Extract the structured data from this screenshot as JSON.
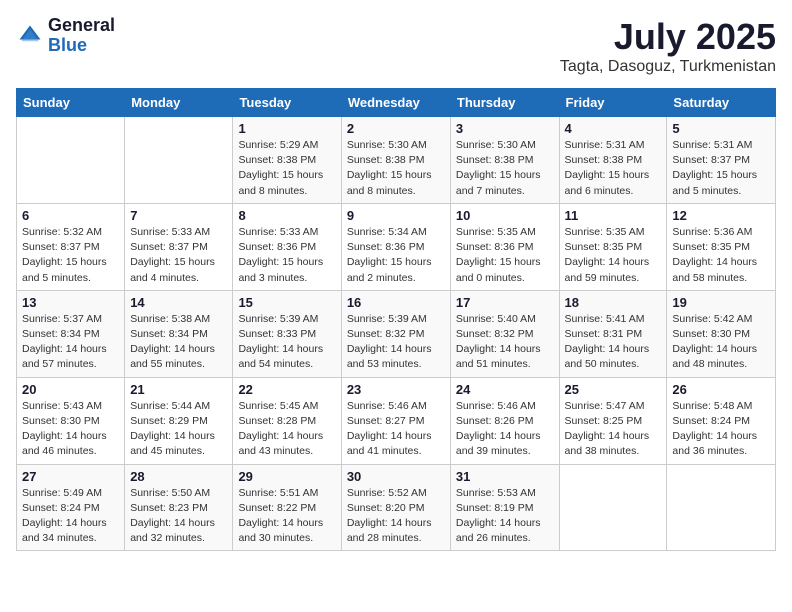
{
  "logo": {
    "general": "General",
    "blue": "Blue"
  },
  "title": "July 2025",
  "subtitle": "Tagta, Dasoguz, Turkmenistan",
  "weekdays": [
    "Sunday",
    "Monday",
    "Tuesday",
    "Wednesday",
    "Thursday",
    "Friday",
    "Saturday"
  ],
  "weeks": [
    [
      {
        "day": "",
        "info": ""
      },
      {
        "day": "",
        "info": ""
      },
      {
        "day": "1",
        "info": "Sunrise: 5:29 AM\nSunset: 8:38 PM\nDaylight: 15 hours and 8 minutes."
      },
      {
        "day": "2",
        "info": "Sunrise: 5:30 AM\nSunset: 8:38 PM\nDaylight: 15 hours and 8 minutes."
      },
      {
        "day": "3",
        "info": "Sunrise: 5:30 AM\nSunset: 8:38 PM\nDaylight: 15 hours and 7 minutes."
      },
      {
        "day": "4",
        "info": "Sunrise: 5:31 AM\nSunset: 8:38 PM\nDaylight: 15 hours and 6 minutes."
      },
      {
        "day": "5",
        "info": "Sunrise: 5:31 AM\nSunset: 8:37 PM\nDaylight: 15 hours and 5 minutes."
      }
    ],
    [
      {
        "day": "6",
        "info": "Sunrise: 5:32 AM\nSunset: 8:37 PM\nDaylight: 15 hours and 5 minutes."
      },
      {
        "day": "7",
        "info": "Sunrise: 5:33 AM\nSunset: 8:37 PM\nDaylight: 15 hours and 4 minutes."
      },
      {
        "day": "8",
        "info": "Sunrise: 5:33 AM\nSunset: 8:36 PM\nDaylight: 15 hours and 3 minutes."
      },
      {
        "day": "9",
        "info": "Sunrise: 5:34 AM\nSunset: 8:36 PM\nDaylight: 15 hours and 2 minutes."
      },
      {
        "day": "10",
        "info": "Sunrise: 5:35 AM\nSunset: 8:36 PM\nDaylight: 15 hours and 0 minutes."
      },
      {
        "day": "11",
        "info": "Sunrise: 5:35 AM\nSunset: 8:35 PM\nDaylight: 14 hours and 59 minutes."
      },
      {
        "day": "12",
        "info": "Sunrise: 5:36 AM\nSunset: 8:35 PM\nDaylight: 14 hours and 58 minutes."
      }
    ],
    [
      {
        "day": "13",
        "info": "Sunrise: 5:37 AM\nSunset: 8:34 PM\nDaylight: 14 hours and 57 minutes."
      },
      {
        "day": "14",
        "info": "Sunrise: 5:38 AM\nSunset: 8:34 PM\nDaylight: 14 hours and 55 minutes."
      },
      {
        "day": "15",
        "info": "Sunrise: 5:39 AM\nSunset: 8:33 PM\nDaylight: 14 hours and 54 minutes."
      },
      {
        "day": "16",
        "info": "Sunrise: 5:39 AM\nSunset: 8:32 PM\nDaylight: 14 hours and 53 minutes."
      },
      {
        "day": "17",
        "info": "Sunrise: 5:40 AM\nSunset: 8:32 PM\nDaylight: 14 hours and 51 minutes."
      },
      {
        "day": "18",
        "info": "Sunrise: 5:41 AM\nSunset: 8:31 PM\nDaylight: 14 hours and 50 minutes."
      },
      {
        "day": "19",
        "info": "Sunrise: 5:42 AM\nSunset: 8:30 PM\nDaylight: 14 hours and 48 minutes."
      }
    ],
    [
      {
        "day": "20",
        "info": "Sunrise: 5:43 AM\nSunset: 8:30 PM\nDaylight: 14 hours and 46 minutes."
      },
      {
        "day": "21",
        "info": "Sunrise: 5:44 AM\nSunset: 8:29 PM\nDaylight: 14 hours and 45 minutes."
      },
      {
        "day": "22",
        "info": "Sunrise: 5:45 AM\nSunset: 8:28 PM\nDaylight: 14 hours and 43 minutes."
      },
      {
        "day": "23",
        "info": "Sunrise: 5:46 AM\nSunset: 8:27 PM\nDaylight: 14 hours and 41 minutes."
      },
      {
        "day": "24",
        "info": "Sunrise: 5:46 AM\nSunset: 8:26 PM\nDaylight: 14 hours and 39 minutes."
      },
      {
        "day": "25",
        "info": "Sunrise: 5:47 AM\nSunset: 8:25 PM\nDaylight: 14 hours and 38 minutes."
      },
      {
        "day": "26",
        "info": "Sunrise: 5:48 AM\nSunset: 8:24 PM\nDaylight: 14 hours and 36 minutes."
      }
    ],
    [
      {
        "day": "27",
        "info": "Sunrise: 5:49 AM\nSunset: 8:24 PM\nDaylight: 14 hours and 34 minutes."
      },
      {
        "day": "28",
        "info": "Sunrise: 5:50 AM\nSunset: 8:23 PM\nDaylight: 14 hours and 32 minutes."
      },
      {
        "day": "29",
        "info": "Sunrise: 5:51 AM\nSunset: 8:22 PM\nDaylight: 14 hours and 30 minutes."
      },
      {
        "day": "30",
        "info": "Sunrise: 5:52 AM\nSunset: 8:20 PM\nDaylight: 14 hours and 28 minutes."
      },
      {
        "day": "31",
        "info": "Sunrise: 5:53 AM\nSunset: 8:19 PM\nDaylight: 14 hours and 26 minutes."
      },
      {
        "day": "",
        "info": ""
      },
      {
        "day": "",
        "info": ""
      }
    ]
  ]
}
